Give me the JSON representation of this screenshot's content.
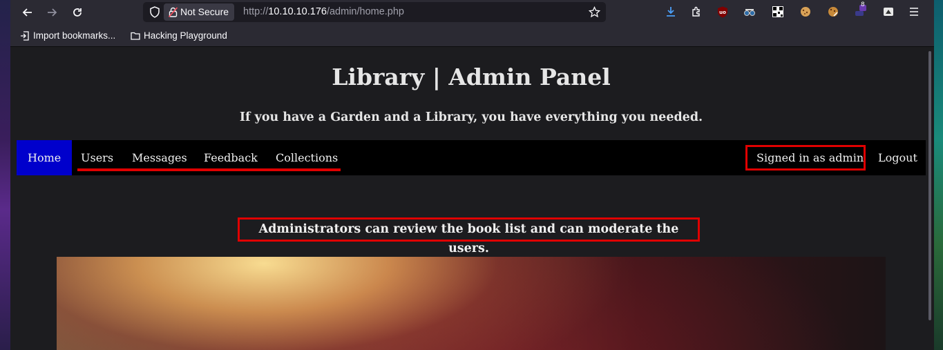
{
  "browser": {
    "security_label": "Not Secure",
    "url_prefix": "http://",
    "url_host": "10.10.10.176",
    "url_path": "/admin/home.php",
    "extension_badge": "8",
    "bookmarks": [
      {
        "label": "Import bookmarks...",
        "icon": "import-icon"
      },
      {
        "label": "Hacking Playground",
        "icon": "folder-icon"
      }
    ]
  },
  "site": {
    "title": "Library | Admin Panel",
    "tagline": "If you have a Garden and a Library, you have everything you needed."
  },
  "navbar": {
    "items": [
      {
        "label": "Home",
        "active": true
      },
      {
        "label": "Users"
      },
      {
        "label": "Messages"
      },
      {
        "label": "Feedback"
      },
      {
        "label": "Collections"
      }
    ],
    "signed_in": "Signed in as admin",
    "logout": "Logout"
  },
  "main": {
    "notice": "Administrators can review the book list and can moderate the users."
  },
  "colors": {
    "nav_active": "#0000cc",
    "highlight": "#e00000",
    "navbar_bg": "#000000"
  }
}
